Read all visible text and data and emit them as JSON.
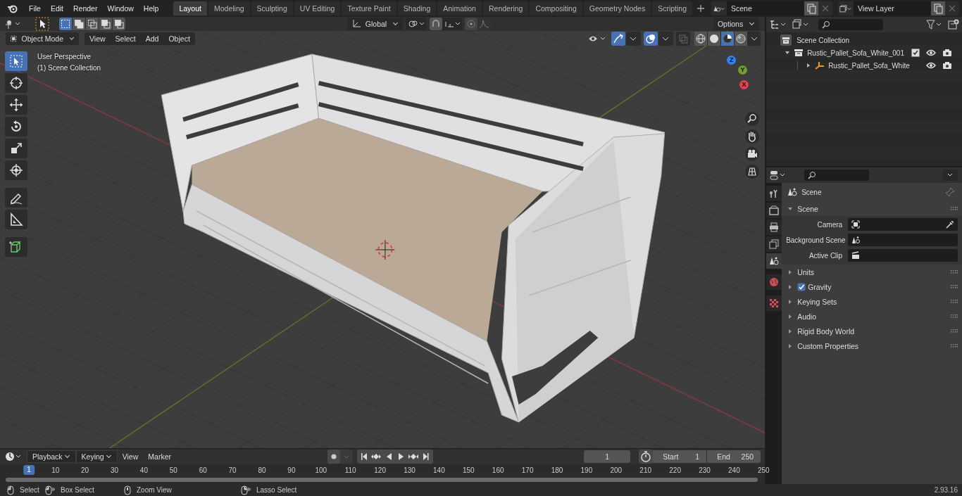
{
  "top_bar": {
    "menus": [
      "File",
      "Edit",
      "Render",
      "Window",
      "Help"
    ],
    "workspaces": [
      {
        "label": "Layout",
        "selected": true
      },
      {
        "label": "Modeling",
        "selected": false
      },
      {
        "label": "Sculpting",
        "selected": false
      },
      {
        "label": "UV Editing",
        "selected": false
      },
      {
        "label": "Texture Paint",
        "selected": false
      },
      {
        "label": "Shading",
        "selected": false
      },
      {
        "label": "Animation",
        "selected": false
      },
      {
        "label": "Rendering",
        "selected": false
      },
      {
        "label": "Compositing",
        "selected": false
      },
      {
        "label": "Geometry Nodes",
        "selected": false
      },
      {
        "label": "Scripting",
        "selected": false
      }
    ],
    "scene": {
      "value": "Scene"
    },
    "view_layer": {
      "value": "View Layer"
    }
  },
  "tool_settings": {
    "selection_modes": [
      {
        "selected": true
      },
      {
        "selected": false
      },
      {
        "selected": false
      },
      {
        "selected": false
      },
      {
        "selected": false
      }
    ],
    "orientation": "Global",
    "options": "Options"
  },
  "viewport_header": {
    "mode": "Object Mode",
    "menus": [
      "View",
      "Select",
      "Add",
      "Object"
    ],
    "shading_modes": [
      {
        "kind": "wireframe",
        "selected": false
      },
      {
        "kind": "solid",
        "selected": false
      },
      {
        "kind": "material",
        "selected": true
      },
      {
        "kind": "rendered",
        "selected": false
      }
    ]
  },
  "viewport": {
    "view_name": "User Perspective",
    "collection": "(1) Scene Collection",
    "tools": [
      {
        "kind": "select",
        "selected": true
      },
      {
        "kind": "cursor",
        "selected": false
      },
      {
        "kind": "move",
        "selected": false
      },
      {
        "kind": "rotate",
        "selected": false
      },
      {
        "kind": "scale",
        "selected": false
      },
      {
        "kind": "transform",
        "selected": false
      },
      {
        "kind": "annotate",
        "selected": false
      },
      {
        "kind": "measure",
        "selected": false
      },
      {
        "kind": "add_cube",
        "selected": false
      }
    ],
    "gizmo_axes": [
      {
        "label": "Z",
        "color": "#2f83f0"
      },
      {
        "label": "Y",
        "color": "#6ea02c"
      },
      {
        "label": "X",
        "color": "#e5404f"
      }
    ]
  },
  "outliner": {
    "root": "Scene Collection",
    "items": [
      {
        "label": "Rustic_Pallet_Sofa_White_001",
        "expanded": true,
        "checked": true,
        "children": [
          {
            "label": "Rustic_Pallet_Sofa_White",
            "expanded": false
          }
        ]
      }
    ]
  },
  "properties": {
    "tabs": [
      {
        "kind": "tool",
        "selected": false
      },
      {
        "kind": "render",
        "selected": false
      },
      {
        "kind": "output",
        "selected": false
      },
      {
        "kind": "view_layer",
        "selected": false
      },
      {
        "kind": "scene",
        "selected": true
      },
      {
        "kind": "world",
        "selected": false
      },
      {
        "kind": "texture",
        "selected": false
      }
    ],
    "context": "Scene",
    "panel": {
      "title": "Scene",
      "expanded": true,
      "fields": [
        {
          "label": "Camera",
          "kind": "camera"
        },
        {
          "label": "Background Scene",
          "kind": "scene"
        },
        {
          "label": "Active Clip",
          "kind": "clip"
        }
      ]
    },
    "sections": [
      {
        "label": "Units",
        "kind": "plain"
      },
      {
        "label": "Gravity",
        "kind": "checkbox",
        "checked": true
      },
      {
        "label": "Keying Sets",
        "kind": "plain"
      },
      {
        "label": "Audio",
        "kind": "plain"
      },
      {
        "label": "Rigid Body World",
        "kind": "plain"
      },
      {
        "label": "Custom Properties",
        "kind": "plain"
      }
    ]
  },
  "timeline": {
    "menus": [
      {
        "label": "Playback",
        "kind": "dropdown"
      },
      {
        "label": "Keying",
        "kind": "dropdown"
      },
      {
        "label": "View",
        "kind": "menu"
      },
      {
        "label": "Marker",
        "kind": "menu"
      }
    ],
    "current_frame": "1",
    "start_label": "Start",
    "start": "1",
    "end_label": "End",
    "end": "250",
    "ruler": [
      {
        "label": "1",
        "selected": true
      },
      {
        "label": "10",
        "selected": false
      },
      {
        "label": "20",
        "selected": false
      },
      {
        "label": "30",
        "selected": false
      },
      {
        "label": "40",
        "selected": false
      },
      {
        "label": "50",
        "selected": false
      },
      {
        "label": "60",
        "selected": false
      },
      {
        "label": "70",
        "selected": false
      },
      {
        "label": "80",
        "selected": false
      },
      {
        "label": "90",
        "selected": false
      },
      {
        "label": "100",
        "selected": false
      },
      {
        "label": "110",
        "selected": false
      },
      {
        "label": "120",
        "selected": false
      },
      {
        "label": "130",
        "selected": false
      },
      {
        "label": "140",
        "selected": false
      },
      {
        "label": "150",
        "selected": false
      },
      {
        "label": "160",
        "selected": false
      },
      {
        "label": "170",
        "selected": false
      },
      {
        "label": "180",
        "selected": false
      },
      {
        "label": "190",
        "selected": false
      },
      {
        "label": "200",
        "selected": false
      },
      {
        "label": "210",
        "selected": false
      },
      {
        "label": "220",
        "selected": false
      },
      {
        "label": "230",
        "selected": false
      },
      {
        "label": "240",
        "selected": false
      },
      {
        "label": "250",
        "selected": false
      }
    ]
  },
  "status_bar": {
    "hints": [
      {
        "kind": "left",
        "label": "Select"
      },
      {
        "kind": "drag",
        "label": "Box Select"
      },
      {
        "kind": "middle",
        "label": "Zoom View"
      },
      {
        "kind": "right",
        "label": "Lasso Select"
      }
    ],
    "version": "2.93.16"
  }
}
